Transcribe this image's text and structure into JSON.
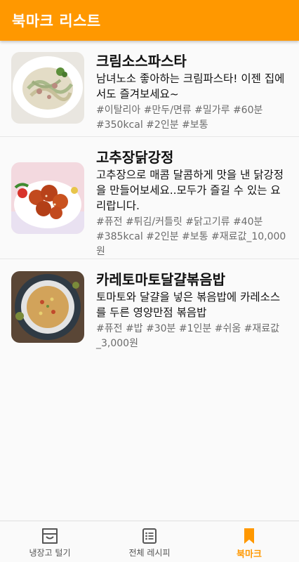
{
  "appbar": {
    "title": "북마크 리스트"
  },
  "recipes": [
    {
      "title": "크림소스파스타",
      "description": "남녀노소 좋아하는 크림파스타! 이젠 집에서도 즐겨보세요~",
      "tags": "#이탈리아 #만두/면류 #밀가루 #60분 #350kcal #2인분 #보통",
      "image_icon": "cream-pasta-photo"
    },
    {
      "title": "고추장닭강정",
      "description": "고추장으로 매콤 달콤하게 맛을 낸 닭강정을 만들어보세요..모두가 즐길 수 있는 요리랍니다.",
      "tags": "#퓨전 #튀김/커틀릿 #닭고기류 #40분 #385kcal #2인분 #보통 #재료값_10,000원",
      "image_icon": "fried-chicken-photo"
    },
    {
      "title": "카레토마토달걀볶음밥",
      "description": "토마토와 달걀을 넣은 볶음밥에 카레소스를 두른 영양만점 볶음밥",
      "tags": "#퓨전 #밥 #30분 #1인분 #쉬움 #재료값_3,000원",
      "image_icon": "fried-rice-photo"
    }
  ],
  "bottom_nav": {
    "items": [
      {
        "label": "냉장고 털기",
        "icon": "fridge-icon",
        "active": false
      },
      {
        "label": "전체 레시피",
        "icon": "list-icon",
        "active": false
      },
      {
        "label": "북마크",
        "icon": "bookmark-icon",
        "active": true
      }
    ]
  },
  "colors": {
    "accent": "#ff9800",
    "text": "#111111",
    "muted": "#6b6b6b"
  }
}
